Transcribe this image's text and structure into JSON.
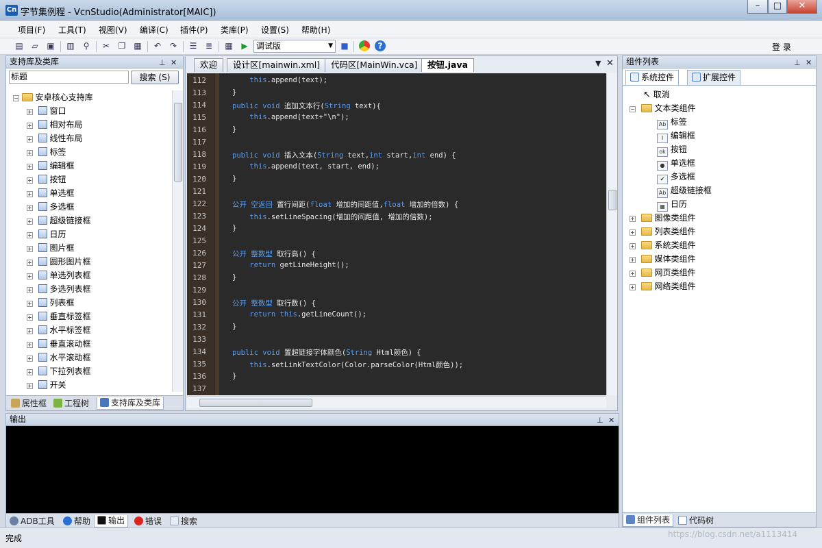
{
  "window": {
    "title": "字节集例程 - VcnStudio(Administrator[MAIC])",
    "app_icon": "Cn",
    "minimize": "–",
    "maximize": "□",
    "close": "✕"
  },
  "menu": [
    "项目(F)",
    "工具(T)",
    "视图(V)",
    "编译(C)",
    "插件(P)",
    "类库(P)",
    "设置(S)",
    "帮助(H)"
  ],
  "toolbar": {
    "build_mode": "调试版",
    "login": "登 录"
  },
  "left_panel": {
    "title": "支持库及类库",
    "search_value": "标题",
    "search_button": "搜索 (S)",
    "root": "安卓核心支持库",
    "items": [
      "窗口",
      "相对布局",
      "线性布局",
      "标签",
      "编辑框",
      "按钮",
      "单选框",
      "多选框",
      "超级链接框",
      "日历",
      "图片框",
      "圆形图片框",
      "单选列表框",
      "多选列表框",
      "列表框",
      "垂直标签框",
      "水平标签框",
      "垂直滚动框",
      "水平滚动框",
      "下拉列表框",
      "开关"
    ],
    "tabs": [
      "属性框",
      "工程树",
      "支持库及类库"
    ]
  },
  "editor": {
    "tabs": [
      "欢迎",
      "设计区[mainwin.xml]",
      "代码区[MainWin.vca]",
      "按钮.java"
    ],
    "lines": [
      {
        "n": "112",
        "text": "    this.append(text);"
      },
      {
        "n": "113",
        "text": "}"
      },
      {
        "n": "114",
        "text": "public void 追加文本行(String text){"
      },
      {
        "n": "115",
        "text": "    this.append(text+\"\\n\");"
      },
      {
        "n": "116",
        "text": "}"
      },
      {
        "n": "117",
        "text": ""
      },
      {
        "n": "118",
        "text": "public void 插入文本(String text,int start,int end) {"
      },
      {
        "n": "119",
        "text": "    this.append(text, start, end);"
      },
      {
        "n": "120",
        "text": "}"
      },
      {
        "n": "121",
        "text": ""
      },
      {
        "n": "122",
        "text": "公开 空返回 置行间距(float 增加的间距值,float 增加的倍数) {"
      },
      {
        "n": "123",
        "text": "    this.setLineSpacing(增加的间距值, 增加的倍数);"
      },
      {
        "n": "124",
        "text": "}"
      },
      {
        "n": "125",
        "text": ""
      },
      {
        "n": "126",
        "text": "公开 整数型 取行高() {"
      },
      {
        "n": "127",
        "text": "    return getLineHeight();"
      },
      {
        "n": "128",
        "text": "}"
      },
      {
        "n": "129",
        "text": ""
      },
      {
        "n": "130",
        "text": "公开 整数型 取行数() {"
      },
      {
        "n": "131",
        "text": "    return this.getLineCount();"
      },
      {
        "n": "132",
        "text": "}"
      },
      {
        "n": "133",
        "text": ""
      },
      {
        "n": "134",
        "text": "public void 置超链接字体颜色(String Html颜色) {"
      },
      {
        "n": "135",
        "text": "    this.setLinkTextColor(Color.parseColor(Html颜色));"
      },
      {
        "n": "136",
        "text": "}"
      },
      {
        "n": "137",
        "text": ""
      }
    ]
  },
  "right_panel": {
    "title": "组件列表",
    "tabs": [
      "系统控件",
      "扩展控件"
    ],
    "cancel": "取消",
    "text_group": "文本类组件",
    "text_items": [
      "标签",
      "编辑框",
      "按钮",
      "单选框",
      "多选框",
      "超级链接框",
      "日历"
    ],
    "groups": [
      "图像类组件",
      "列表类组件",
      "系统类组件",
      "媒体类组件",
      "网页类组件",
      "网络类组件"
    ],
    "bottom_tabs": [
      "组件列表",
      "代码树"
    ]
  },
  "output": {
    "title": "输出",
    "tabs": [
      "ADB工具",
      "帮助",
      "输出",
      "错误",
      "搜索"
    ]
  },
  "status": {
    "text": "完成",
    "watermark": "https://blog.csdn.net/a1113414"
  }
}
